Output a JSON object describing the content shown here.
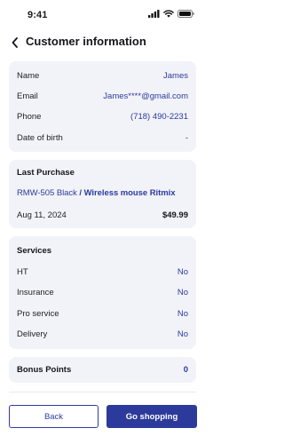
{
  "status_bar": {
    "time": "9:41",
    "icons": [
      "signal-icon",
      "wifi-icon",
      "battery-icon"
    ]
  },
  "header": {
    "title": "Customer information",
    "back_icon": "chevron-left-icon"
  },
  "personal": {
    "rows": [
      {
        "label": "Name",
        "value": "James"
      },
      {
        "label": "Email",
        "value": "James****@gmail.com"
      },
      {
        "label": "Phone",
        "value": "(718) 490-2231"
      },
      {
        "label": "Date of birth",
        "value": "-"
      }
    ]
  },
  "last_purchase": {
    "title": "Last Purchase",
    "product_code": "RMW-505 Black",
    "separator": " / ",
    "product_name": "Wireless mouse Ritmix",
    "date": "Aug 11, 2024",
    "price": "$49.99"
  },
  "services": {
    "title": "Services",
    "rows": [
      {
        "label": "HT",
        "value": "No"
      },
      {
        "label": "Insurance",
        "value": "No"
      },
      {
        "label": "Pro service",
        "value": "No"
      },
      {
        "label": "Delivery",
        "value": "No"
      }
    ]
  },
  "bonus": {
    "label": "Bonus Points",
    "value": "0"
  },
  "actions": {
    "back_label": "Back",
    "shop_label": "Go shopping"
  },
  "colors": {
    "accent": "#2c3a9b",
    "link": "#2d3a9f",
    "card_bg": "#f2f3f8",
    "divider": "#e8e9ef"
  }
}
